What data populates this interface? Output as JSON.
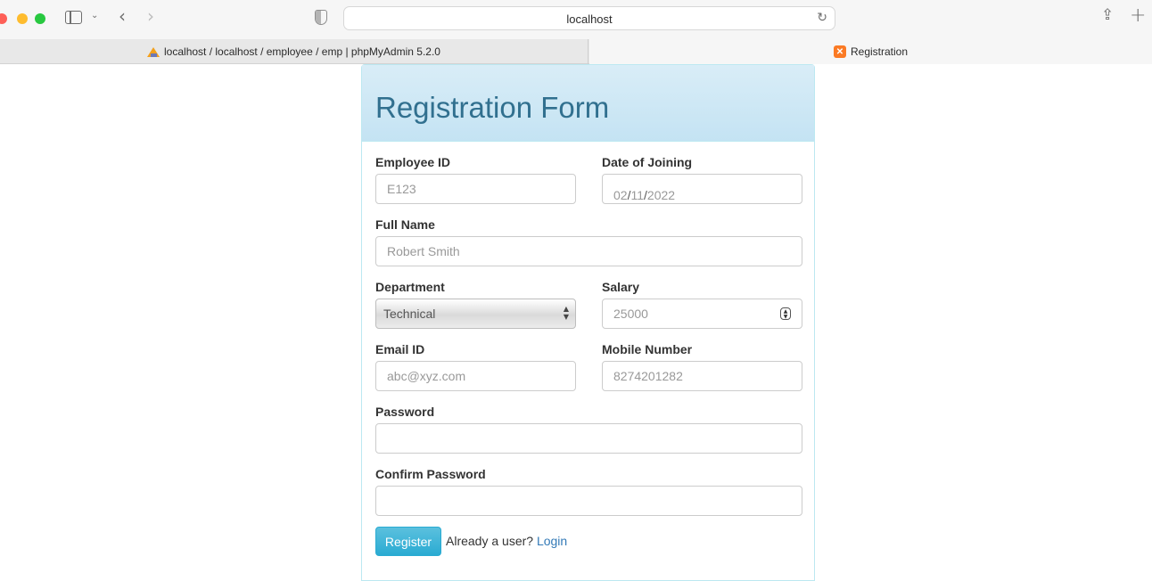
{
  "browser": {
    "address": "localhost",
    "tabs": [
      {
        "label": "localhost / localhost / employee / emp | phpMyAdmin 5.2.0",
        "icon": "phpmyadmin-icon"
      },
      {
        "label": "Registration",
        "icon": "xampp-icon"
      }
    ]
  },
  "form": {
    "title": "Registration Form",
    "employee_id": {
      "label": "Employee ID",
      "placeholder": "E123"
    },
    "date_of_joining": {
      "label": "Date of Joining",
      "month": "02",
      "day": "11",
      "year": "2022",
      "separator": "/"
    },
    "full_name": {
      "label": "Full Name",
      "placeholder": "Robert Smith"
    },
    "department": {
      "label": "Department",
      "selected": "Technical"
    },
    "salary": {
      "label": "Salary",
      "placeholder": "25000"
    },
    "email": {
      "label": "Email ID",
      "placeholder": "abc@xyz.com"
    },
    "mobile": {
      "label": "Mobile Number",
      "placeholder": "8274201282"
    },
    "password": {
      "label": "Password",
      "value": ""
    },
    "confirm_password": {
      "label": "Confirm Password",
      "value": ""
    },
    "register_label": "Register",
    "already_user": "Already a user?",
    "login_label": "Login"
  },
  "colors": {
    "header_text": "#31708f",
    "header_bg": "#d9edf7",
    "button": "#5bc0de",
    "link": "#337ab7"
  }
}
